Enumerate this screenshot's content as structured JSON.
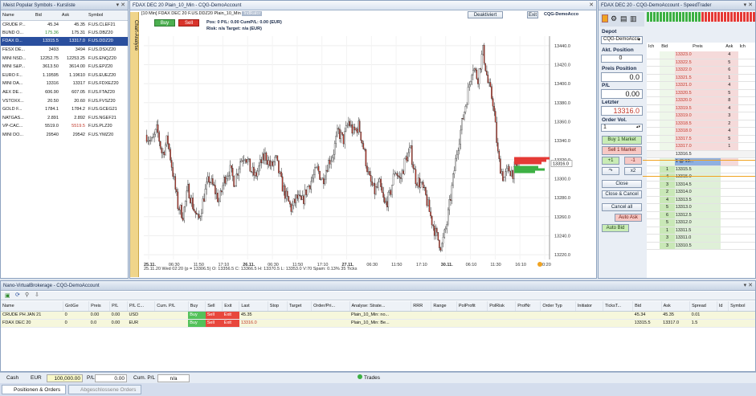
{
  "quotes": {
    "title": "Meist Popular Symbols - Kursliste",
    "headers": [
      "Name",
      "Bid",
      "Ask",
      "Symbol"
    ],
    "rows": [
      [
        "CRUDE P...",
        "45.34",
        "45.35",
        "F.US.CLEF21"
      ],
      [
        "BUND O...",
        "175.36",
        "175.31",
        "F.US.DBZ20"
      ],
      [
        "FDAX D...",
        "13315.5",
        "13317.0",
        "F.US.DDZ20"
      ],
      [
        "FESX DE...",
        "3493",
        "3494",
        "F.US.DSXZ20"
      ],
      [
        "MINI NSD...",
        "12252.75",
        "12253.25",
        "F.US.ENQZ20"
      ],
      [
        "MINI S&P...",
        "3613.50",
        "3614.00",
        "F.US.EPZ20"
      ],
      [
        "EURO F...",
        "1.19595",
        "1.19610",
        "F.US.EUEZ20"
      ],
      [
        "MINI DA...",
        "13316",
        "13317",
        "F.US.FDXEZ20"
      ],
      [
        "AEX DE...",
        "606.90",
        "607.05",
        "F.US.FTAZ20"
      ],
      [
        "VSTOXX...",
        "20.50",
        "20.60",
        "F.US.FVSZ20"
      ],
      [
        "GOLD F...",
        "1784.1",
        "1784.2",
        "F.US.GCEG21"
      ],
      [
        "NATGAS...",
        "2.891",
        "2.892",
        "F.US.NGEF21"
      ],
      [
        "VP-CAC...",
        "5519.0",
        "5519.5",
        "F.US.PLZ20"
      ],
      [
        "MINI DO...",
        "29540",
        "29542",
        "F.US.YMZ20"
      ]
    ]
  },
  "chart": {
    "tab_label": "FDAX DEC 20  Plain_10_Min - CQG-DemoAccount",
    "header": "[10 Min] FDAX DEC 20  F.US.DDZ20 Plain_10_Min",
    "header_badge": "Indikator",
    "buy_label": "Buy",
    "sell_label": "Sell",
    "pos_line": "Pos: 0  P/L: 0.00  CumP/L: 0.00 (EUR)",
    "risk_line": "Risk: n/a  Target: n/a (EUR)",
    "deaktiviert": "Deaktiviert",
    "exit": "Exit",
    "account_label": "CQG-DemoAcco",
    "side_tab": "Chart-Analyse",
    "yticks": [
      "13440.0",
      "13420.0",
      "13400.0",
      "13380.0",
      "13360.0",
      "13340.0",
      "13320.0",
      "13300.0",
      "13280.0",
      "13260.0",
      "13240.0",
      "13220.0"
    ],
    "price_tag": "13316.0",
    "xticks": [
      "25.11.",
      "06:30",
      "11:50",
      "17:10",
      "26.11.",
      "06:30",
      "11:50",
      "17:10",
      "27.11.",
      "06:30",
      "11:50",
      "17:10",
      "30.11.",
      "06:10",
      "11:30",
      "16:10",
      "20:20"
    ],
    "info": "25.11.20 Wed 02:20 (p = 13306.5)    O: 13356.5 C: 13366.5 H: 13370.5 L: 13353.0 V:70 Spam: 0.13% 35 Ticks",
    "series_range": [
      13225,
      13445
    ]
  },
  "chart_data": {
    "type": "line",
    "title": "FDAX DEC 20 F.US.DDZ20 10 Min",
    "ylim": [
      13220,
      13450
    ],
    "y": [
      13346,
      13338,
      13352,
      13325,
      13342,
      13308,
      13272,
      13262,
      13290,
      13270,
      13255,
      13280,
      13300,
      13290,
      13276,
      13300,
      13310,
      13296,
      13318,
      13326,
      13310,
      13302,
      13316,
      13325,
      13312,
      13320,
      13296,
      13280,
      13268,
      13280,
      13274,
      13290,
      13300,
      13310,
      13298,
      13316,
      13326,
      13350,
      13340,
      13360,
      13348,
      13356,
      13330,
      13300,
      13286,
      13294,
      13272,
      13282,
      13310,
      13298,
      13320,
      13330,
      13300,
      13294,
      13280,
      13258,
      13240,
      13228,
      13252,
      13290,
      13330,
      13360,
      13388,
      13420,
      13405,
      13435,
      13400,
      13380,
      13320,
      13300,
      13310,
      13306,
      13316
    ]
  },
  "speedtrader": {
    "title": "FDAX DEC 20 - CQG-DemoAccount - SpeedTrader",
    "depot_label": "Depot",
    "account": "CQG-DemoAcco",
    "akt_position_label": "Akt. Position",
    "akt_position": "0",
    "preis_position_label": "Preis Position",
    "preis_position": "0.0",
    "pl_label": "P/L",
    "pl": "0.00",
    "letzter_label": "Letzter",
    "letzter": "13316.0",
    "order_vol_label": "Order Vol.",
    "order_vol": "1",
    "buttons": [
      "Buy 1 Market",
      "Sell 1 Market",
      "+1",
      "-1",
      "x2",
      "Close",
      "Close & Cancel",
      "Cancel all",
      "Auto Ask",
      "Auto Bid"
    ],
    "ladder_headers": [
      "Ich",
      "Bid",
      "Preis",
      "Ask",
      "Ich"
    ],
    "ladder": [
      {
        "p": "13323.0",
        "a": "4",
        "t": "ask"
      },
      {
        "p": "13322.5",
        "a": "5",
        "t": "ask"
      },
      {
        "p": "13322.0",
        "a": "6",
        "t": "ask"
      },
      {
        "p": "13321.5",
        "a": "1",
        "t": "ask"
      },
      {
        "p": "13321.0",
        "a": "4",
        "t": "ask"
      },
      {
        "p": "13320.5",
        "a": "5",
        "t": "ask"
      },
      {
        "p": "13320.0",
        "a": "8",
        "t": "ask"
      },
      {
        "p": "13319.5",
        "a": "4",
        "t": "ask"
      },
      {
        "p": "13319.0",
        "a": "3",
        "t": "ask"
      },
      {
        "p": "13318.5",
        "a": "2",
        "t": "ask"
      },
      {
        "p": "13318.0",
        "a": "4",
        "t": "ask"
      },
      {
        "p": "13317.5",
        "a": "5",
        "t": "ask"
      },
      {
        "p": "13317.0",
        "a": "1",
        "t": "ask"
      },
      {
        "p": "13316.5",
        "a": "",
        "t": "mid"
      },
      {
        "p": "1 @ 13...",
        "a": "",
        "t": "cur"
      },
      {
        "p": "13315.5",
        "b": "1",
        "t": "bid"
      },
      {
        "p": "13315.0",
        "b": "4",
        "t": "bid"
      },
      {
        "p": "13314.5",
        "b": "3",
        "t": "bid"
      },
      {
        "p": "13314.0",
        "b": "2",
        "t": "bid"
      },
      {
        "p": "13313.5",
        "b": "4",
        "t": "bid"
      },
      {
        "p": "13313.0",
        "b": "5",
        "t": "bid"
      },
      {
        "p": "13312.5",
        "b": "6",
        "t": "bid"
      },
      {
        "p": "13312.0",
        "b": "5",
        "t": "bid"
      },
      {
        "p": "13311.5",
        "b": "1",
        "t": "bid"
      },
      {
        "p": "13311.0",
        "b": "3",
        "t": "bid"
      },
      {
        "p": "13310.5",
        "b": "3",
        "t": "bid"
      }
    ]
  },
  "brokerage": {
    "title": "Nano-VirtualBrokerage - CQG-DemoAccount",
    "headers": [
      "Name",
      "GröGe",
      "Preis",
      "P/L",
      "P/L C...",
      "Cum. P/L",
      "Buy",
      "Sell",
      "Exit",
      "Last",
      "Stop",
      "Target",
      "Order/Pri...",
      "Analyse: Strate...",
      "RRR",
      "Range",
      "PolProfit",
      "PolRisk",
      "ProfNr",
      "Order Typ",
      "Initiator",
      "TicksT...",
      "Bid",
      "Ask",
      "Spread",
      "Id",
      "Symbol"
    ],
    "rows": [
      [
        "CRUDE PH JAN 21",
        "0",
        "0.00",
        "0.00",
        "USD",
        "",
        "Buy",
        "Sell",
        "Exit",
        "45.35",
        "",
        "",
        "",
        "Plain_10_Min: no...",
        "",
        "",
        "",
        "",
        "",
        "",
        "",
        "",
        "45.34",
        "45.35",
        "0.01",
        "",
        ""
      ],
      [
        "FDAX DEC 20",
        "0",
        "0.0",
        "0.00",
        "EUR",
        "",
        "Buy",
        "Sell",
        "Exit",
        "13316.0",
        "",
        "",
        "",
        "Plain_10_Min: Be...",
        "",
        "",
        "",
        "",
        "",
        "",
        "",
        "",
        "13315.5",
        "13317.0",
        "1.5",
        "",
        ""
      ]
    ]
  },
  "status": {
    "cash_label": "Cash",
    "currency": "EUR",
    "cash": "100,000.00",
    "pl_label": "P/L",
    "pl": "0.00",
    "cum_label": "Cum. P/L",
    "cum": "n/a",
    "trades": "Trades"
  },
  "tabs": [
    "Positionen & Orders",
    "Abgeschlossene Orders"
  ]
}
